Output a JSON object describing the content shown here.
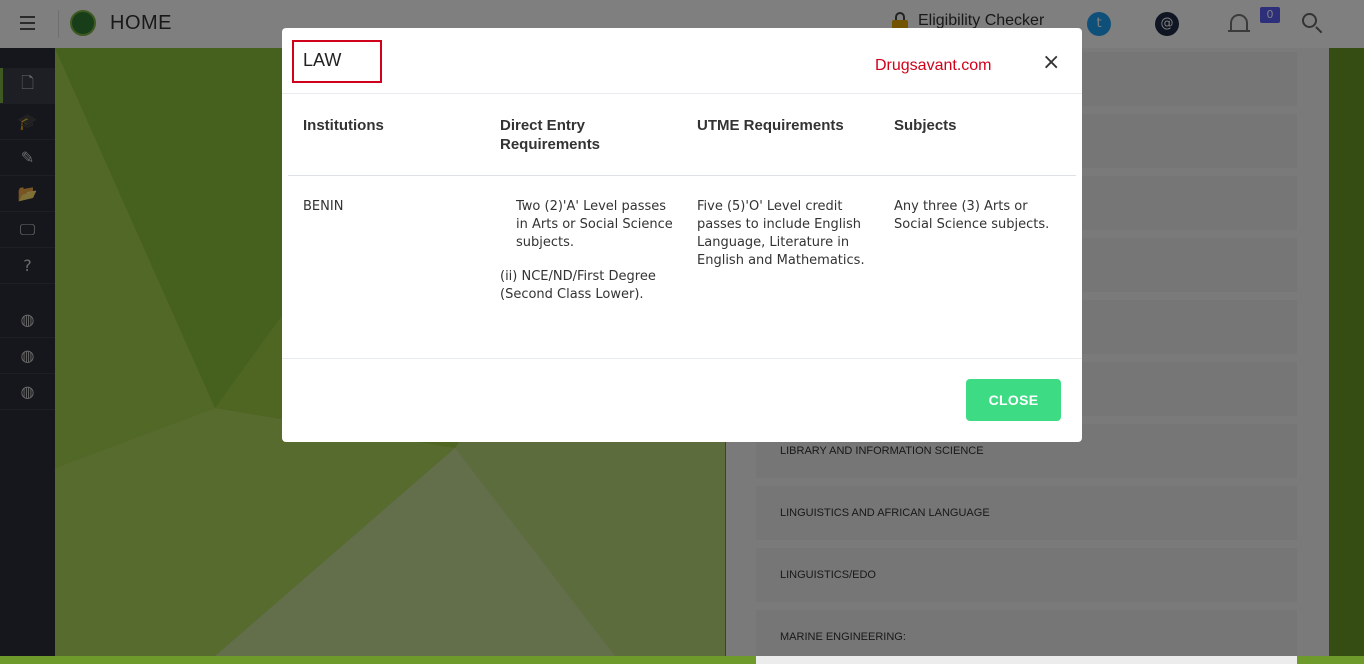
{
  "topbar": {
    "title": "HOME",
    "eligibility_label": "Eligibility Checker",
    "twitter_glyph": "t",
    "email_glyph": "@",
    "notification_count": "0"
  },
  "sidebar": {
    "items": [
      {
        "icon": "file-icon",
        "glyph": "🗋"
      },
      {
        "icon": "graduation-cap-icon",
        "glyph": "🎓"
      },
      {
        "icon": "edit-icon",
        "glyph": "✎"
      },
      {
        "icon": "folder-open-icon",
        "glyph": "📂"
      },
      {
        "icon": "monitor-icon",
        "glyph": "🖵"
      },
      {
        "icon": "question-icon",
        "glyph": "?"
      },
      {
        "icon": "globe-icon",
        "glyph": "◍"
      },
      {
        "icon": "globe-icon",
        "glyph": "◍"
      },
      {
        "icon": "globe-icon",
        "glyph": "◍"
      }
    ]
  },
  "background_list": {
    "items": [
      "LIBRARY AND INFORMATION SCIENCE",
      "LINGUISTICS AND AFRICAN LANGUAGE",
      "LINGUISTICS/EDO",
      "MARINE ENGINEERING:"
    ]
  },
  "modal": {
    "title": "LAW",
    "watermark": "Drugsavant.com",
    "close_x": "×",
    "columns": [
      "Institutions",
      "Direct Entry Requirements",
      "UTME Requirements",
      "Subjects"
    ],
    "row": {
      "institution": "BENIN",
      "direct_entry_1": "Two (2)'A' Level passes in Arts or Social Science subjects.",
      "direct_entry_2": "(ii)   NCE/ND/First Degree (Second Class Lower).",
      "utme": "Five (5)'O' Level credit passes to include English Language, Literature in English and Mathematics.",
      "subjects": "Any three (3) Arts or Social Science subjects."
    },
    "close_button_label": "CLOSE"
  },
  "colors": {
    "accent_green": "#3ddc84",
    "highlight_red": "#d0021b",
    "sidebar_bg": "#2c2f3a",
    "badge": "#5b5ef6"
  }
}
